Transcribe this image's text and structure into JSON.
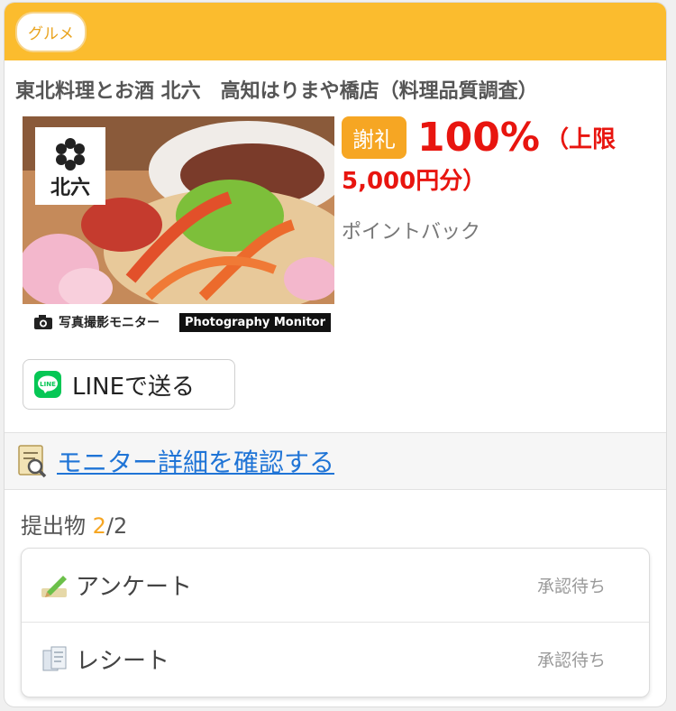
{
  "header": {
    "genre": "グルメ"
  },
  "store": {
    "title": "東北料理とお酒 北六　高知はりまや橋店（料理品質調査）"
  },
  "photo": {
    "logo_text": "北六",
    "bar_label_jp": "写真撮影モニター",
    "bar_label_en": "Photography Monitor"
  },
  "reward": {
    "badge": "謝礼",
    "percent": "100%",
    "limit_line1": "（上限",
    "limit_line2": "5,000円分）",
    "type": "ポイントバック"
  },
  "share": {
    "line_label": "LINEで送る",
    "line_icon_text": "LINE"
  },
  "detail": {
    "link_label": "モニター詳細を確認する"
  },
  "submissions": {
    "label": "提出物",
    "current": "2",
    "sep_total": "/2",
    "items": [
      {
        "label": "アンケート",
        "status": "承認待ち"
      },
      {
        "label": "レシート",
        "status": "承認待ち"
      }
    ]
  },
  "colors": {
    "accent": "#fbbc2e",
    "reward_red": "#e8150f",
    "badge_orange": "#f6a623",
    "link_blue": "#1f74d6",
    "line_green": "#06c755"
  },
  "icons": [
    "camera-icon",
    "line-icon",
    "monitor-detail-icon",
    "pencil-icon",
    "receipt-icon"
  ]
}
